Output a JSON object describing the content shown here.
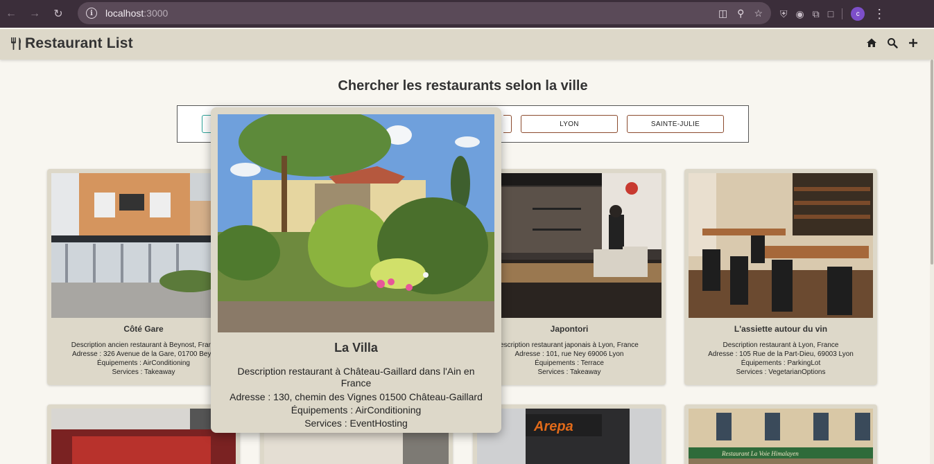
{
  "browser": {
    "url_host": "localhost",
    "url_port": ":3000",
    "profile_initial": "c"
  },
  "app": {
    "title": "Restaurant List"
  },
  "search": {
    "heading": "Chercher les restaurants selon la ville",
    "cities": [
      "LYON",
      "SAINTE-JULIE"
    ]
  },
  "restaurants": [
    {
      "name": "Côté Gare",
      "description": "Description ancien restaurant à Beynost, Franc",
      "address": "Adresse : 326 Avenue de la Gare, 01700 Beyn",
      "equipment": "Équipements : AirConditioning",
      "services": "Services : Takeaway"
    },
    {
      "name": "Japontori",
      "description": "escription restaurant japonais à Lyon, France",
      "address": "Adresse : 101, rue Ney 69006 Lyon",
      "equipment": "Équipements : Terrace",
      "services": "Services : Takeaway"
    },
    {
      "name": "L'assiette autour du vin",
      "description": "Description restaurant à Lyon, France",
      "address": "Adresse : 105 Rue de la Part-Dieu, 69003 Lyon",
      "equipment": "Équipements : ParkingLot",
      "services": "Services : VegetarianOptions"
    }
  ],
  "featured": {
    "name": "La Villa",
    "description": "Description restaurant à Château-Gaillard dans l'Ain en France",
    "address": "Adresse : 130, chemin des Vignes 01500 Château-Gaillard",
    "equipment": "Équipements : AirConditioning",
    "services": "Services : EventHosting"
  },
  "storefront_signs": {
    "arepa": "Arepa",
    "himalaya": "Restaurant La Voie Himalayen"
  },
  "colors": {
    "header_bg": "#ddd8c9",
    "page_bg": "#f8f6f0",
    "button_border": "#8b4a2d",
    "active_button_border": "#2aa198"
  }
}
